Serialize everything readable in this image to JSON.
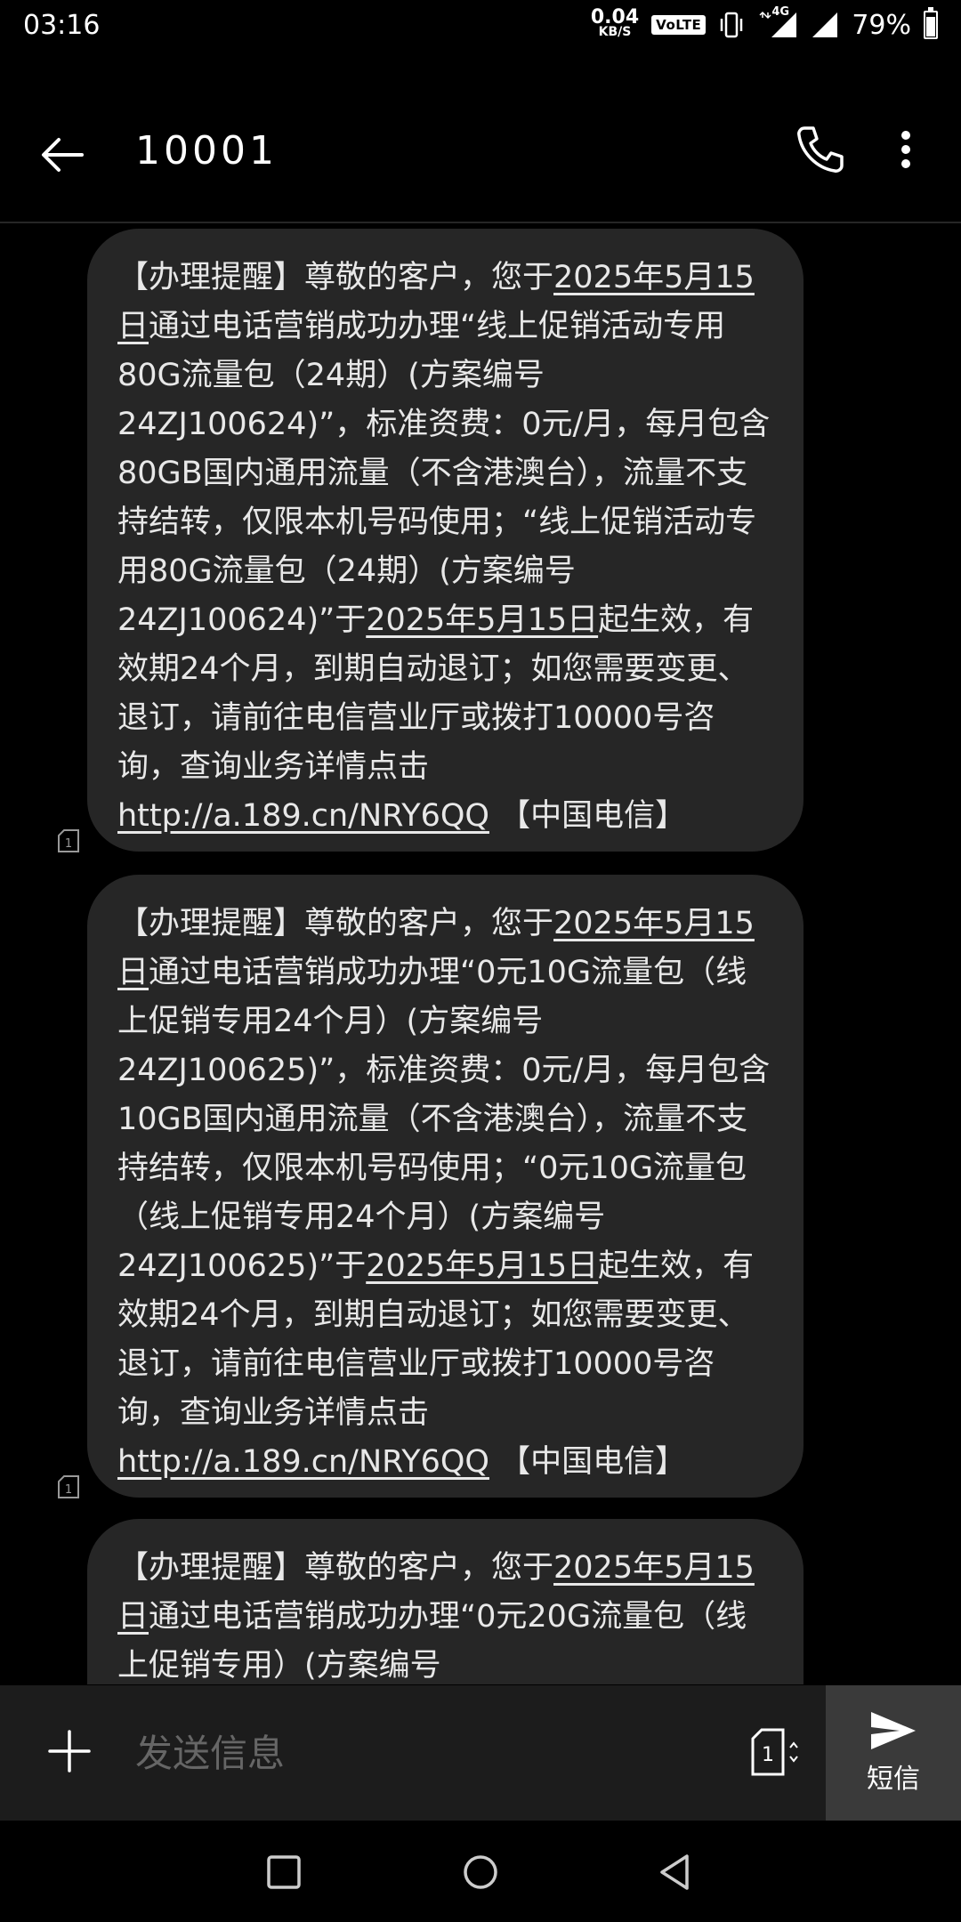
{
  "status_bar": {
    "time": "03:16",
    "net_speed_value": "0.04",
    "net_speed_unit": "KB/S",
    "volte": "VoLTE",
    "network": "4G",
    "battery": "79%"
  },
  "header": {
    "title": "10001"
  },
  "messages": [
    {
      "segments": [
        {
          "text": "【办理提醒】尊敬的客户，您于",
          "u": false
        },
        {
          "text": "2025年5月15日",
          "u": true
        },
        {
          "text": "通过电话营销成功办理“线上促销活动专用80G流量包（24期）(方案编号24ZJ100624)”，标准资费：0元/月，每月包含80GB国内通用流量（不含港澳台），流量不支持结转，仅限本机号码使用；“线上促销活动专用80G流量包（24期）(方案编号24ZJ100624)”于",
          "u": false
        },
        {
          "text": "2025年5月15日",
          "u": true
        },
        {
          "text": "起生效，有效期24个月，到期自动退订；如您需要变更、退订，请前往电信营业厅或拨打10000号咨询，查询业务详情点击",
          "u": false
        },
        {
          "text": "http://a.189.cn/NRY6QQ",
          "u": true
        },
        {
          "text": " 【中国电信】",
          "u": false
        }
      ]
    },
    {
      "segments": [
        {
          "text": "【办理提醒】尊敬的客户，您于",
          "u": false
        },
        {
          "text": "2025年5月15日",
          "u": true
        },
        {
          "text": "通过电话营销成功办理“0元10G流量包（线上促销专用24个月）(方案编号24ZJ100625)”，标准资费：0元/月，每月包含10GB国内通用流量（不含港澳台），流量不支持结转，仅限本机号码使用；“0元10G流量包（线上促销专用24个月）(方案编号24ZJ100625)”于",
          "u": false
        },
        {
          "text": "2025年5月15日",
          "u": true
        },
        {
          "text": "起生效，有效期24个月，到期自动退订；如您需要变更、退订，请前往电信营业厅或拨打10000号咨询，查询业务详情点击",
          "u": false
        },
        {
          "text": "http://a.189.cn/NRY6QQ",
          "u": true
        },
        {
          "text": " 【中国电信】",
          "u": false
        }
      ]
    },
    {
      "segments": [
        {
          "text": "【办理提醒】尊敬的客户，您于",
          "u": false
        },
        {
          "text": "2025年5月15日",
          "u": true
        },
        {
          "text": "通过电话营销成功办理“0元20G流量包（线上促销专用）(方案编号",
          "u": false
        }
      ]
    }
  ],
  "sim_label": "1",
  "composer": {
    "placeholder": "发送信息",
    "sim_label": "1",
    "send_label": "短信"
  },
  "icons": {
    "back": "arrow-left-icon",
    "call": "phone-icon",
    "more": "more-vert-icon",
    "add": "plus-icon",
    "send": "send-icon",
    "sim": "sim-card-icon"
  }
}
